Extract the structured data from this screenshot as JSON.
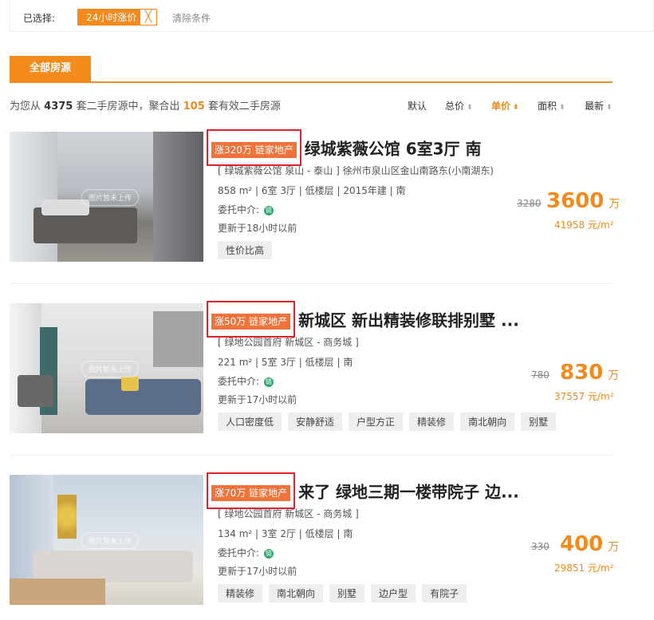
{
  "filter": {
    "label": "已选择:",
    "chip": "24小时涨价",
    "chip_close": "╳",
    "clear": "清除条件"
  },
  "tabs": {
    "all": "全部房源"
  },
  "summary": {
    "pre": "为您从",
    "total": "4375",
    "mid": "套二手房源中，聚合出",
    "count": "105",
    "post": "套有效二手房源"
  },
  "sort": [
    {
      "label": "默认",
      "arrow": ""
    },
    {
      "label": "总价",
      "arrow": "⬍"
    },
    {
      "label": "单价",
      "arrow": "⬍"
    },
    {
      "label": "面积",
      "arrow": "⬍"
    },
    {
      "label": "最新",
      "arrow": "⬍"
    }
  ],
  "listings": [
    {
      "badge": "涨320万 链家地产",
      "title": "绿城紫薇公馆 6室3厅 南",
      "address": "[ 绿城紫薇公馆 泉山 - 泰山 ] 徐州市泉山区金山南路东(小南湖东)",
      "details": "858 m² | 6室 3厅 | 低楼层 | 2015年建 | 南",
      "agent_label": "委托中介:",
      "agent_icon": "链",
      "updated": "更新于18小时以前",
      "tags": [
        "性价比高"
      ],
      "old_price": "3280",
      "price": "3600",
      "price_unit": "万",
      "unit_price": "41958 元/m²",
      "watermark": "图片暂未上传"
    },
    {
      "badge": "涨50万 链家地产",
      "title": "新城区 新出精装修联排别墅 ...",
      "address": "[ 绿地公园首府 新城区 - 商务城 ]",
      "details": "221 m² | 5室 3厅 | 低楼层 | 南",
      "agent_label": "委托中介:",
      "agent_icon": "链",
      "updated": "更新于17小时以前",
      "tags": [
        "人口密度低",
        "安静舒适",
        "户型方正",
        "精装修",
        "南北朝向",
        "别墅"
      ],
      "old_price": "780",
      "price": "830",
      "price_unit": "万",
      "unit_price": "37557 元/m²",
      "watermark": "图片暂未上传"
    },
    {
      "badge": "涨70万 链家地产",
      "title": "来了 绿地三期一楼带院子 边...",
      "address": "[ 绿地公园首府 新城区 - 商务城 ]",
      "details": "134 m² | 3室 2厅 | 低楼层 | 南",
      "agent_label": "委托中介:",
      "agent_icon": "链",
      "updated": "更新于17小时以前",
      "tags": [
        "精装修",
        "南北朝向",
        "别墅",
        "边户型",
        "有院子"
      ],
      "old_price": "330",
      "price": "400",
      "price_unit": "万",
      "unit_price": "29851 元/m²",
      "watermark": "图片暂未上传"
    }
  ]
}
